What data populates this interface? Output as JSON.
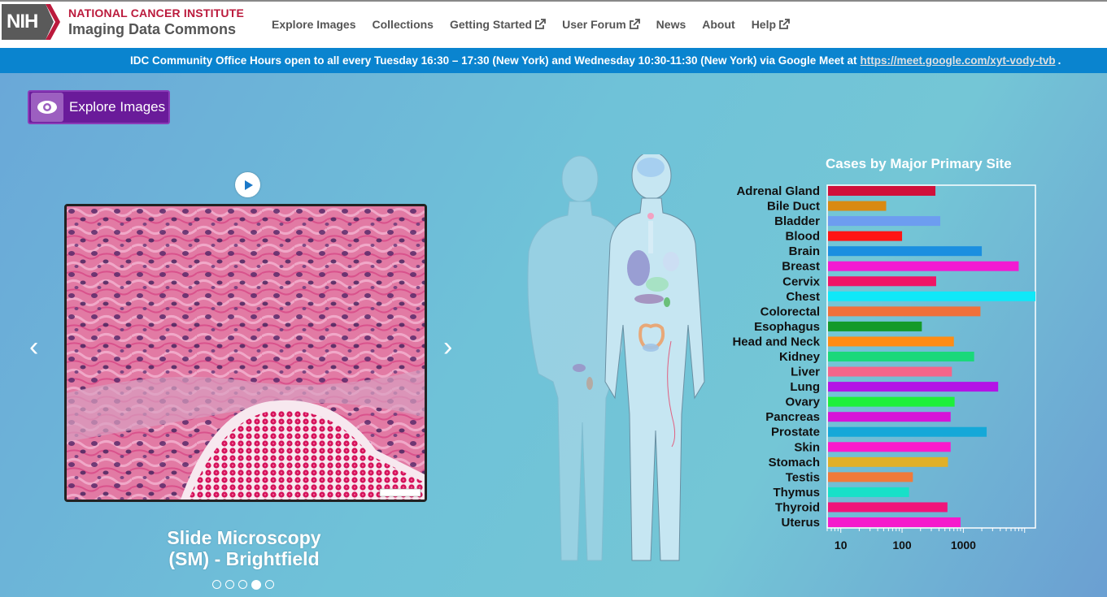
{
  "header": {
    "logo_nih": "NIH",
    "logo_nci": "NATIONAL CANCER INSTITUTE",
    "logo_idc": "Imaging Data Commons",
    "nav": [
      {
        "label": "Explore Images",
        "external": false
      },
      {
        "label": "Collections",
        "external": false
      },
      {
        "label": "Getting Started",
        "external": true
      },
      {
        "label": "User Forum",
        "external": true
      },
      {
        "label": "News",
        "external": false
      },
      {
        "label": "About",
        "external": false
      },
      {
        "label": "Help",
        "external": true
      }
    ]
  },
  "banner": {
    "text": "IDC Community Office Hours open to all every Tuesday 16:30 – 17:30 (New York) and Wednesday 10:30-11:30 (New York) via Google Meet at",
    "link": "https://meet.google.com/xyt-vody-tvb",
    "suffix": "."
  },
  "main": {
    "explore_button": "Explore Images",
    "carousel": {
      "title_line1": "Slide Microscopy",
      "title_line2": "(SM) - Brightfield",
      "slide_count": 5,
      "active_index": 3,
      "prev_glyph": "‹",
      "next_glyph": "›"
    }
  },
  "chart_data": {
    "type": "bar",
    "orientation": "horizontal",
    "title": "Cases by Major Primary Site",
    "x_scale": "log",
    "xlim": [
      6,
      15000
    ],
    "x_ticks": [
      10,
      100,
      1000
    ],
    "x_tick_labels": [
      "10",
      "100",
      "1000"
    ],
    "categories": [
      "Adrenal Gland",
      "Bile Duct",
      "Bladder",
      "Blood",
      "Brain",
      "Breast",
      "Cervix",
      "Chest",
      "Colorectal",
      "Esophagus",
      "Head and Neck",
      "Kidney",
      "Liver",
      "Lung",
      "Ovary",
      "Pancreas",
      "Prostate",
      "Skin",
      "Stomach",
      "Testis",
      "Thymus",
      "Thyroid",
      "Uterus"
    ],
    "values": [
      350,
      55,
      420,
      100,
      2000,
      8000,
      360,
      15000,
      1900,
      210,
      700,
      1500,
      650,
      3700,
      720,
      620,
      2400,
      620,
      560,
      150,
      130,
      550,
      900
    ],
    "colors": [
      "#d0103a",
      "#d98a12",
      "#6d9df0",
      "#ff1414",
      "#1b8fe0",
      "#f21ad2",
      "#f01466",
      "#10e8f8",
      "#f0703a",
      "#149a2a",
      "#ff8c14",
      "#1ad87a",
      "#f4658a",
      "#b314e6",
      "#1ef03a",
      "#d614d8",
      "#15a8d8",
      "#fa1acc",
      "#e0b028",
      "#f07a3a",
      "#18e0c8",
      "#f0147a",
      "#f51acc"
    ]
  }
}
